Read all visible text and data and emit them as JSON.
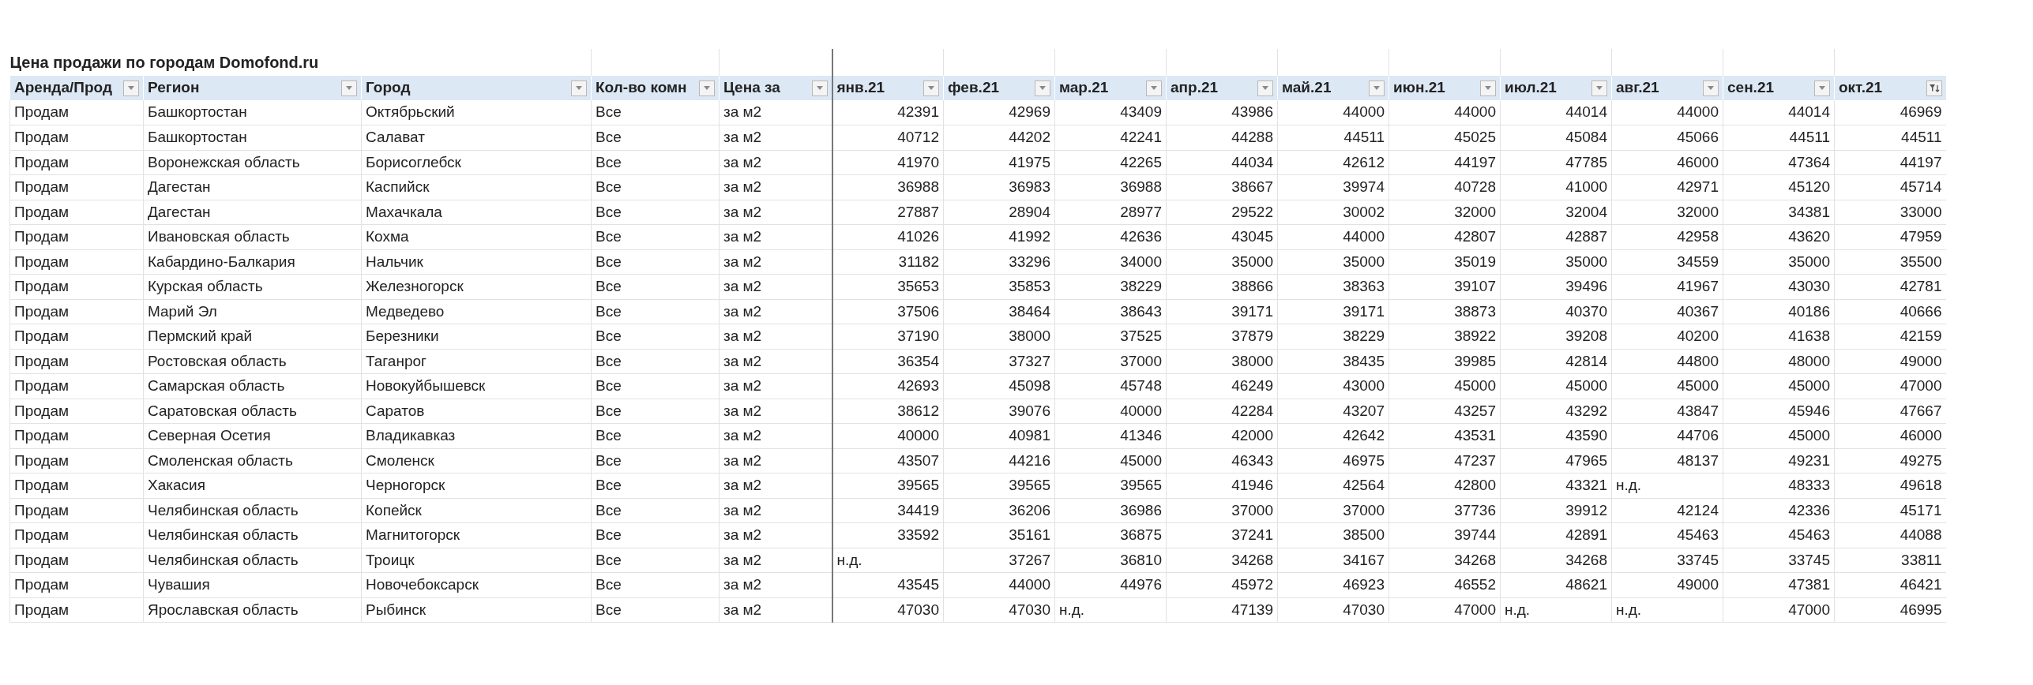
{
  "title": "Цена продажи по городам Domofond.ru",
  "columns": [
    {
      "label": "Аренда/Прод",
      "filtered": false
    },
    {
      "label": "Регион",
      "filtered": false
    },
    {
      "label": "Город",
      "filtered": false
    },
    {
      "label": "Кол-во комн",
      "filtered": false
    },
    {
      "label": "Цена за",
      "filtered": false
    },
    {
      "label": "янв.21",
      "filtered": false
    },
    {
      "label": "фев.21",
      "filtered": false
    },
    {
      "label": "мар.21",
      "filtered": false
    },
    {
      "label": "апр.21",
      "filtered": false
    },
    {
      "label": "май.21",
      "filtered": false
    },
    {
      "label": "июн.21",
      "filtered": false
    },
    {
      "label": "июл.21",
      "filtered": false
    },
    {
      "label": "авг.21",
      "filtered": false
    },
    {
      "label": "сен.21",
      "filtered": false
    },
    {
      "label": "окт.21",
      "filtered": true
    }
  ],
  "rows": [
    [
      "Продам",
      "Башкортостан",
      "Октябрьский",
      "Все",
      "за м2",
      "42391",
      "42969",
      "43409",
      "43986",
      "44000",
      "44000",
      "44014",
      "44000",
      "44014",
      "46969"
    ],
    [
      "Продам",
      "Башкортостан",
      "Салават",
      "Все",
      "за м2",
      "40712",
      "44202",
      "42241",
      "44288",
      "44511",
      "45025",
      "45084",
      "45066",
      "44511",
      "44511"
    ],
    [
      "Продам",
      "Воронежская область",
      "Борисоглебск",
      "Все",
      "за м2",
      "41970",
      "41975",
      "42265",
      "44034",
      "42612",
      "44197",
      "47785",
      "46000",
      "47364",
      "44197"
    ],
    [
      "Продам",
      "Дагестан",
      "Каспийск",
      "Все",
      "за м2",
      "36988",
      "36983",
      "36988",
      "38667",
      "39974",
      "40728",
      "41000",
      "42971",
      "45120",
      "45714"
    ],
    [
      "Продам",
      "Дагестан",
      "Махачкала",
      "Все",
      "за м2",
      "27887",
      "28904",
      "28977",
      "29522",
      "30002",
      "32000",
      "32004",
      "32000",
      "34381",
      "33000"
    ],
    [
      "Продам",
      "Ивановская область",
      "Кохма",
      "Все",
      "за м2",
      "41026",
      "41992",
      "42636",
      "43045",
      "44000",
      "42807",
      "42887",
      "42958",
      "43620",
      "47959"
    ],
    [
      "Продам",
      "Кабардино-Балкария",
      "Нальчик",
      "Все",
      "за м2",
      "31182",
      "33296",
      "34000",
      "35000",
      "35000",
      "35019",
      "35000",
      "34559",
      "35000",
      "35500"
    ],
    [
      "Продам",
      "Курская область",
      "Железногорск",
      "Все",
      "за м2",
      "35653",
      "35853",
      "38229",
      "38866",
      "38363",
      "39107",
      "39496",
      "41967",
      "43030",
      "42781"
    ],
    [
      "Продам",
      "Марий Эл",
      "Медведево",
      "Все",
      "за м2",
      "37506",
      "38464",
      "38643",
      "39171",
      "39171",
      "38873",
      "40370",
      "40367",
      "40186",
      "40666"
    ],
    [
      "Продам",
      "Пермский край",
      "Березники",
      "Все",
      "за м2",
      "37190",
      "38000",
      "37525",
      "37879",
      "38229",
      "38922",
      "39208",
      "40200",
      "41638",
      "42159"
    ],
    [
      "Продам",
      "Ростовская область",
      "Таганрог",
      "Все",
      "за м2",
      "36354",
      "37327",
      "37000",
      "38000",
      "38435",
      "39985",
      "42814",
      "44800",
      "48000",
      "49000"
    ],
    [
      "Продам",
      "Самарская область",
      "Новокуйбышевск",
      "Все",
      "за м2",
      "42693",
      "45098",
      "45748",
      "46249",
      "43000",
      "45000",
      "45000",
      "45000",
      "45000",
      "47000"
    ],
    [
      "Продам",
      "Саратовская область",
      "Саратов",
      "Все",
      "за м2",
      "38612",
      "39076",
      "40000",
      "42284",
      "43207",
      "43257",
      "43292",
      "43847",
      "45946",
      "47667"
    ],
    [
      "Продам",
      "Северная Осетия",
      "Владикавказ",
      "Все",
      "за м2",
      "40000",
      "40981",
      "41346",
      "42000",
      "42642",
      "43531",
      "43590",
      "44706",
      "45000",
      "46000"
    ],
    [
      "Продам",
      "Смоленская область",
      "Смоленск",
      "Все",
      "за м2",
      "43507",
      "44216",
      "45000",
      "46343",
      "46975",
      "47237",
      "47965",
      "48137",
      "49231",
      "49275"
    ],
    [
      "Продам",
      "Хакасия",
      "Черногорск",
      "Все",
      "за м2",
      "39565",
      "39565",
      "39565",
      "41946",
      "42564",
      "42800",
      "43321",
      "н.д.",
      "48333",
      "49618"
    ],
    [
      "Продам",
      "Челябинская область",
      "Копейск",
      "Все",
      "за м2",
      "34419",
      "36206",
      "36986",
      "37000",
      "37000",
      "37736",
      "39912",
      "42124",
      "42336",
      "45171"
    ],
    [
      "Продам",
      "Челябинская область",
      "Магнитогорск",
      "Все",
      "за м2",
      "33592",
      "35161",
      "36875",
      "37241",
      "38500",
      "39744",
      "42891",
      "45463",
      "45463",
      "44088"
    ],
    [
      "Продам",
      "Челябинская область",
      "Троицк",
      "Все",
      "за м2",
      "н.д.",
      "37267",
      "36810",
      "34268",
      "34167",
      "34268",
      "34268",
      "33745",
      "33745",
      "33811"
    ],
    [
      "Продам",
      "Чувашия",
      "Новочебоксарск",
      "Все",
      "за м2",
      "43545",
      "44000",
      "44976",
      "45972",
      "46923",
      "46552",
      "48621",
      "49000",
      "47381",
      "46421"
    ],
    [
      "Продам",
      "Ярославская область",
      "Рыбинск",
      "Все",
      "за м2",
      "47030",
      "47030",
      "н.д.",
      "47139",
      "47030",
      "47000",
      "н.д.",
      "н.д.",
      "47000",
      "46995"
    ]
  ]
}
